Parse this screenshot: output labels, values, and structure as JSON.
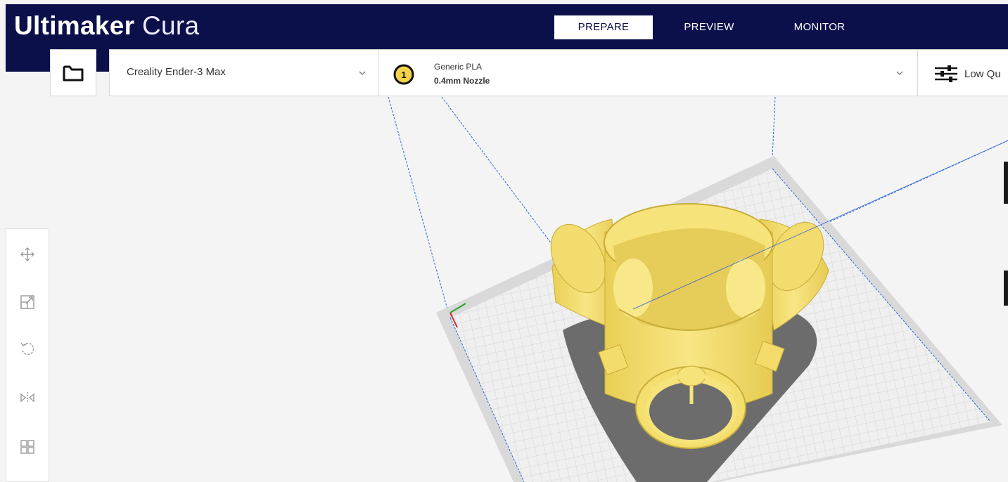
{
  "app": {
    "brand": "Ultimaker",
    "product": "Cura"
  },
  "stages": [
    {
      "label": "PREPARE",
      "active": true
    },
    {
      "label": "PREVIEW",
      "active": false
    },
    {
      "label": "MONITOR",
      "active": false
    }
  ],
  "toolbar": {
    "open_icon": "folder-icon",
    "machine": {
      "name": "Creality Ender-3 Max",
      "icon": "chevron-down-icon"
    },
    "material": {
      "extruder_number": "1",
      "material_name": "Generic PLA",
      "nozzle": "0.4mm Nozzle",
      "icon": "chevron-down-icon"
    },
    "quality": {
      "label": "Low Qu",
      "icon": "sliders-icon"
    }
  },
  "tools": [
    {
      "name": "move-tool",
      "icon": "move-icon"
    },
    {
      "name": "scale-tool",
      "icon": "scale-icon"
    },
    {
      "name": "rotate-tool",
      "icon": "rotate-icon"
    },
    {
      "name": "mirror-tool",
      "icon": "mirror-icon"
    },
    {
      "name": "per-model-settings-tool",
      "icon": "per-model-settings-icon"
    }
  ],
  "colors": {
    "header_bg": "#0b0f4a",
    "model_yellow": "#f6e37a",
    "build_plate": "#dcdcdc",
    "grid_line": "#c8c8c8",
    "build_volume_line": "#2a63d8",
    "shadow": "#6a6a6a"
  }
}
